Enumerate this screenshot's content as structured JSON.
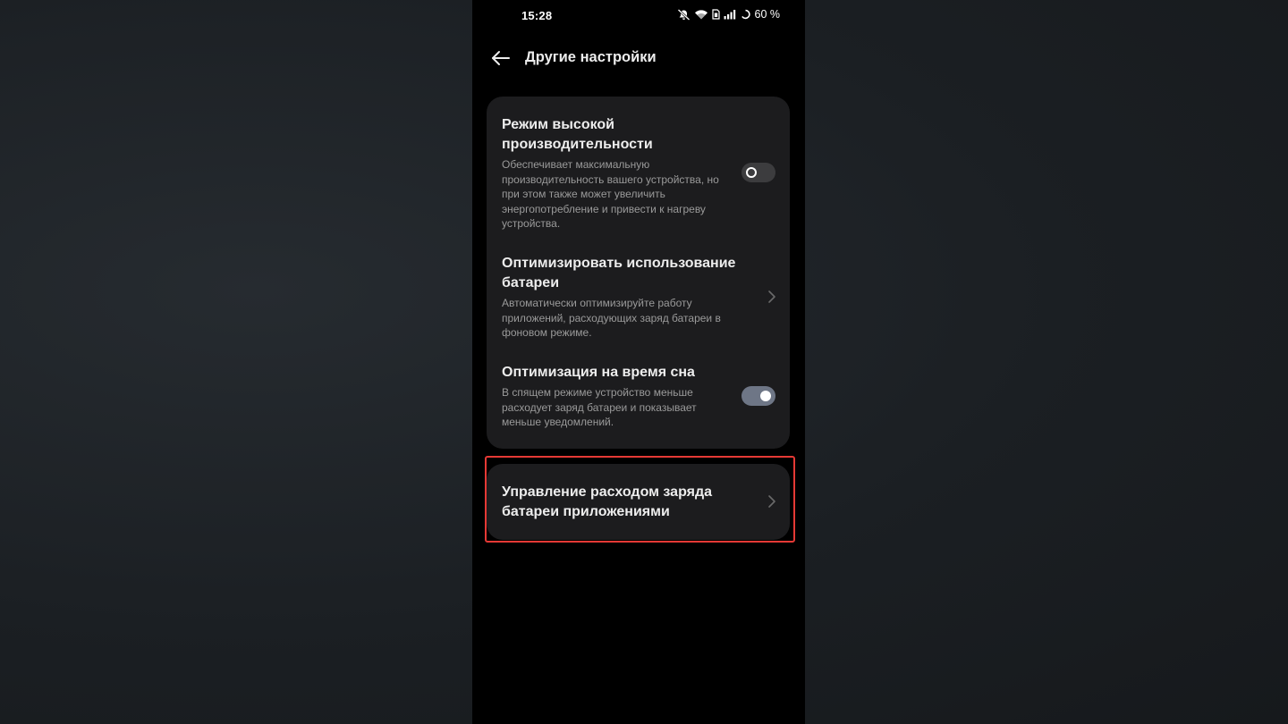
{
  "status_bar": {
    "time": "15:28",
    "icons": [
      "mute-icon",
      "wifi-icon",
      "sim-icon",
      "signal-icon",
      "battery-icon"
    ],
    "battery_percent": "60 %"
  },
  "header": {
    "back_icon": "arrow-left-icon",
    "title": "Другие настройки"
  },
  "settings": {
    "high_performance": {
      "title": "Режим высокой производительности",
      "description": "Обеспечивает максимальную производительность вашего устройства, но при этом также может увеличить энергопотребление и привести к нагреву устройства.",
      "enabled": false
    },
    "optimize_battery": {
      "title": "Оптимизировать использование батареи",
      "description": "Автоматически оптимизируйте работу приложений, расходующих заряд батареи в фоновом режиме."
    },
    "sleep_optimization": {
      "title": "Оптимизация на время сна",
      "description": "В спящем режиме устройство меньше расходует заряд батареи и показывает меньше уведомлений.",
      "enabled": true
    },
    "app_battery_management": {
      "title": "Управление расходом заряда батареи приложениями",
      "highlighted": true
    }
  },
  "colors": {
    "screen_background": "#000000",
    "card_background": "#1c1c1e",
    "toggle_on": "#6e7686",
    "toggle_off": "#3c3c3e",
    "highlight": "#e53935"
  }
}
